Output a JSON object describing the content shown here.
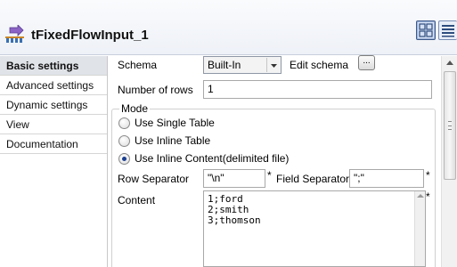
{
  "header": {
    "component_title": "tFixedFlowInput_1",
    "component_icon": "flow-input-icon",
    "view_buttons": [
      "grid-view-icon",
      "list-view-icon"
    ]
  },
  "tabs": [
    {
      "label": "Basic settings",
      "selected": true
    },
    {
      "label": "Advanced settings",
      "selected": false
    },
    {
      "label": "Dynamic settings",
      "selected": false
    },
    {
      "label": "View",
      "selected": false
    },
    {
      "label": "Documentation",
      "selected": false
    }
  ],
  "basic": {
    "schema_label": "Schema",
    "schema_value": "Built-In",
    "edit_schema_label": "Edit schema",
    "edit_schema_button": "...",
    "rows_label": "Number of rows",
    "rows_value": "1",
    "mode": {
      "title": "Mode",
      "options": [
        {
          "label": "Use Single Table",
          "checked": false
        },
        {
          "label": "Use Inline Table",
          "checked": false
        },
        {
          "label": "Use Inline Content(delimited file)",
          "checked": true
        }
      ]
    },
    "row_separator_label": "Row Separator",
    "row_separator_value": "\"\\n\"",
    "field_separator_label": "Field Separator",
    "field_separator_value": "\";\"",
    "required_mark": "*",
    "content_label": "Content",
    "content_lines": [
      "1;ford",
      "2;smith",
      "3;thomson"
    ]
  },
  "colors": {
    "selected_tab_bg": "#e0e3e8",
    "radio_dot": "#1b3f8f"
  }
}
